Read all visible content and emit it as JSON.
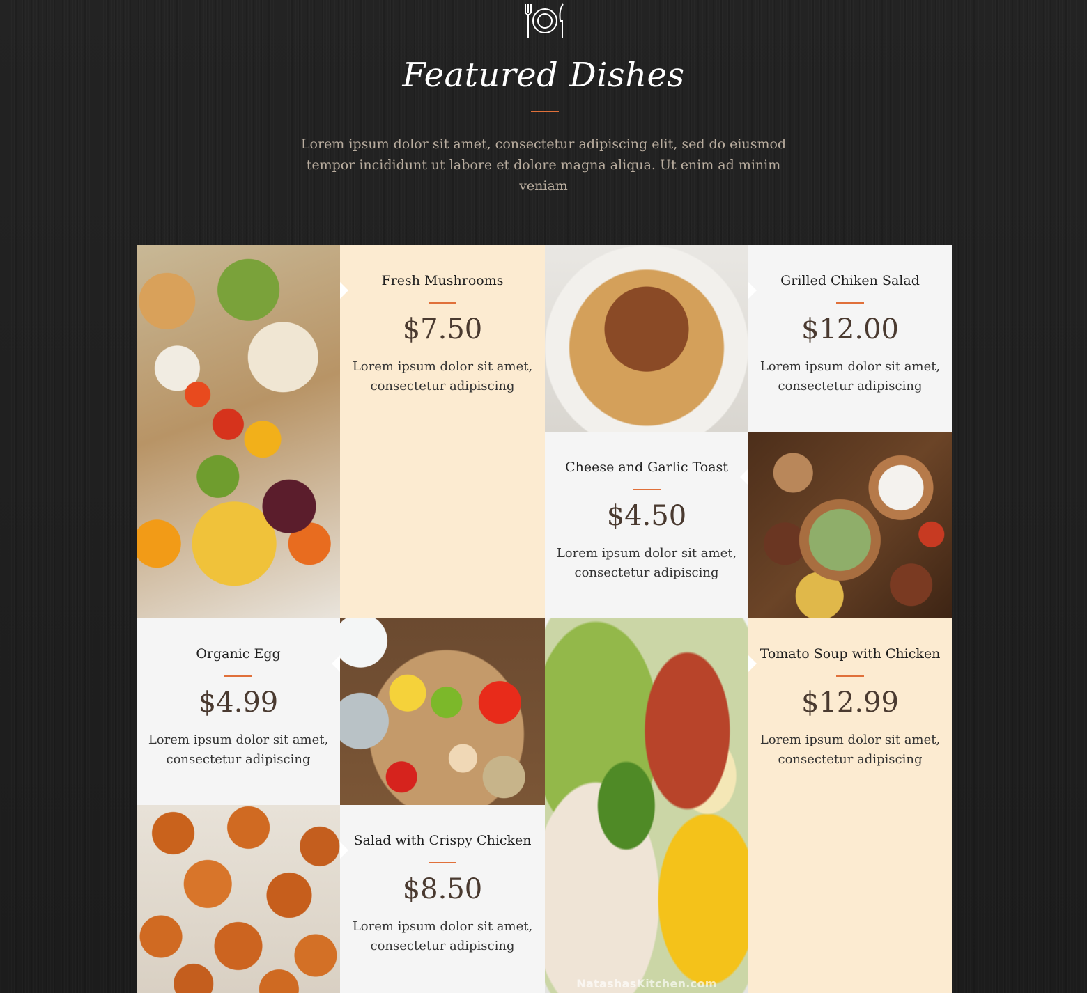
{
  "header": {
    "icon": "plate-fork-knife-icon",
    "title": "Featured Dishes",
    "intro": "Lorem ipsum dolor sit amet, consectetur adipiscing elit, sed do eiusmod tempor incididunt ut labore et dolore magna aliqua. Ut enim ad minim veniam"
  },
  "dishes": [
    {
      "name": "Fresh Mushrooms",
      "price": "$7.50",
      "description": "Lorem ipsum dolor sit amet, consectetur adipiscing"
    },
    {
      "name": "Grilled Chiken Salad",
      "price": "$12.00",
      "description": "Lorem ipsum dolor sit amet, consectetur adipiscing"
    },
    {
      "name": "Cheese and Garlic Toast",
      "price": "$4.50",
      "description": "Lorem ipsum dolor sit amet, consectetur adipiscing"
    },
    {
      "name": "Organic Egg",
      "price": "$4.99",
      "description": "Lorem ipsum dolor sit amet, consectetur adipiscing"
    },
    {
      "name": "Tomato Soup with Chicken",
      "price": "$12.99",
      "description": "Lorem ipsum dolor sit amet, consectetur adipiscing"
    },
    {
      "name": "Salad with Crispy Chicken",
      "price": "$8.50",
      "description": "Lorem ipsum dolor sit amet, consectetur adipiscing"
    }
  ],
  "photos": {
    "groceries": "groceries-photo",
    "pasta": "pasta-photo",
    "feast": "feast-photo",
    "healthy": "healthy-food-photo",
    "cobb": "cobb-salad-photo",
    "sweetpotato": "sweet-potato-photo",
    "watermark": "NatashasKitchen.com"
  },
  "colors": {
    "background": "#1e1e1e",
    "accent": "#e0703a",
    "card_cream": "#fcebd1",
    "card_light": "#f5f5f5",
    "price": "#4a3a30"
  }
}
